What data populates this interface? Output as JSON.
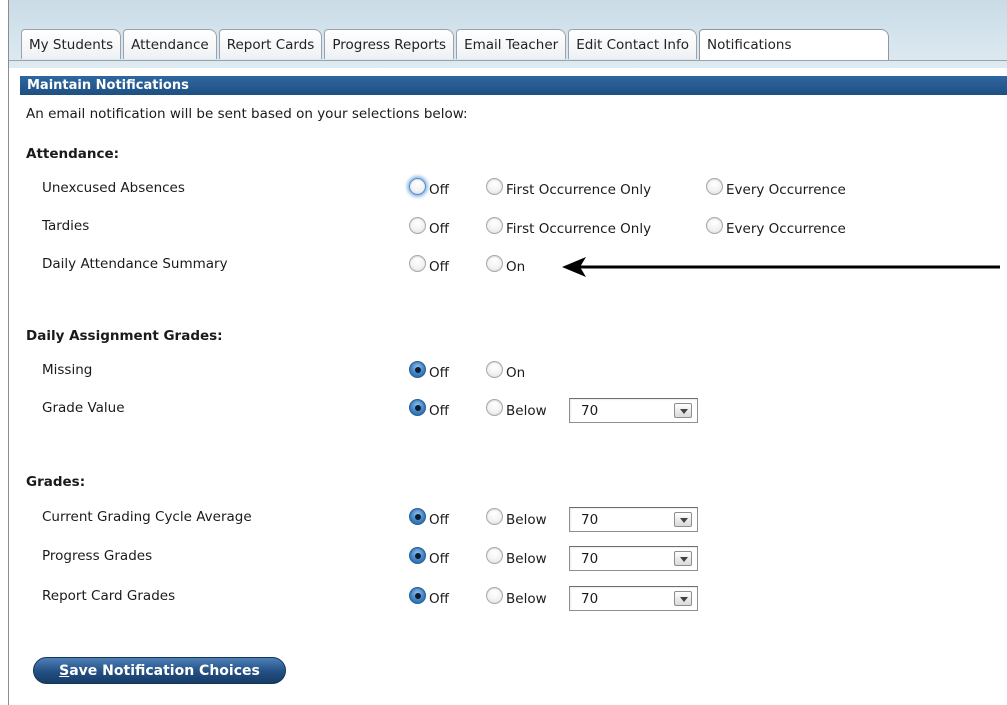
{
  "tabs": [
    {
      "label": "My Students"
    },
    {
      "label": "Attendance"
    },
    {
      "label": "Report Cards"
    },
    {
      "label": "Progress Reports"
    },
    {
      "label": "Email Teacher"
    },
    {
      "label": "Edit Contact Info"
    },
    {
      "label": "Notifications",
      "active": true
    }
  ],
  "panel": {
    "title": "Maintain Notifications",
    "intro": "An email notification will be sent based on your selections below:"
  },
  "attendance": {
    "heading": "Attendance:",
    "unexcused": {
      "label": "Unexcused Absences",
      "off": "Off",
      "first": "First Occurrence Only",
      "every": "Every Occurrence",
      "selected": "none"
    },
    "tardies": {
      "label": "Tardies",
      "off": "Off",
      "first": "First Occurrence Only",
      "every": "Every Occurrence",
      "selected": "none"
    },
    "summary": {
      "label": "Daily Attendance Summary",
      "off": "Off",
      "on": "On",
      "selected": "none"
    }
  },
  "daily_assignment": {
    "heading": "Daily Assignment Grades:",
    "missing": {
      "label": "Missing",
      "off": "Off",
      "on": "On",
      "selected": "Off"
    },
    "grade_value": {
      "label": "Grade Value",
      "off": "Off",
      "below": "Below",
      "threshold": "70",
      "selected": "Off"
    }
  },
  "grades": {
    "heading": "Grades:",
    "cycle_avg": {
      "label": "Current Grading Cycle Average",
      "off": "Off",
      "below": "Below",
      "threshold": "70",
      "selected": "Off"
    },
    "progress": {
      "label": "Progress Grades",
      "off": "Off",
      "below": "Below",
      "threshold": "70",
      "selected": "Off"
    },
    "report_card": {
      "label": "Report Card Grades",
      "off": "Off",
      "below": "Below",
      "threshold": "70",
      "selected": "Off"
    }
  },
  "save_button": {
    "underlined": "S",
    "rest": "ave Notification Choices"
  },
  "colors": {
    "header_blue": "#1f4f82",
    "tab_bg": "#d6e5ee",
    "radio_checked": "#3f82c6"
  },
  "annotation": {
    "arrow_target": "Daily Attendance Summary On option"
  }
}
